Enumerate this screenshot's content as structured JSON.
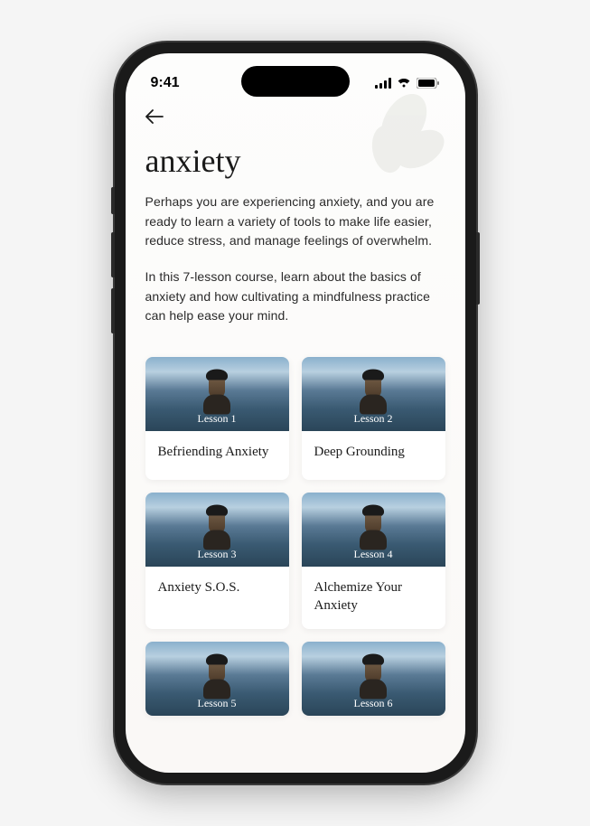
{
  "status": {
    "time": "9:41"
  },
  "page": {
    "title": "anxiety",
    "paragraph1": "Perhaps you are experiencing anxiety, and you are ready to learn a variety of tools to make life easier, reduce stress, and manage feelings of overwhelm.",
    "paragraph2": "In this 7-lesson course, learn about the basics of anxiety and how cultivating a mindfulness practice can help ease your mind."
  },
  "lessons": [
    {
      "label": "Lesson 1",
      "title": "Befriending Anxiety"
    },
    {
      "label": "Lesson 2",
      "title": "Deep Grounding"
    },
    {
      "label": "Lesson 3",
      "title": "Anxiety S.O.S."
    },
    {
      "label": "Lesson 4",
      "title": "Alchemize Your Anxiety"
    },
    {
      "label": "Lesson 5",
      "title": ""
    },
    {
      "label": "Lesson 6",
      "title": ""
    }
  ]
}
